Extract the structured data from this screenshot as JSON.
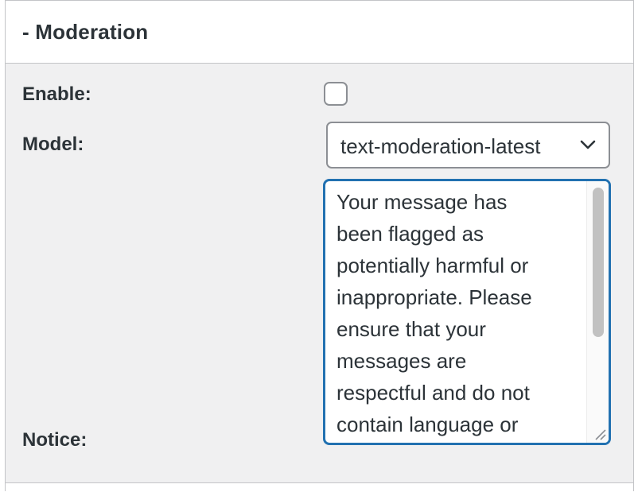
{
  "section": {
    "title": "- Moderation"
  },
  "fields": {
    "enable": {
      "label": "Enable:",
      "checked": false
    },
    "model": {
      "label": "Model:",
      "selected": "text-moderation-latest"
    },
    "notice": {
      "label": "Notice:",
      "value": "Your message has\nbeen flagged as\npotentially harmful or\ninappropriate. Please\nensure that your\nmessages are\nrespectful and do not\ncontain language or"
    }
  },
  "icons": {
    "select": "chevron-down-icon",
    "textarea_resize": "resize-grip-icon"
  },
  "colors": {
    "focus_border": "#2271b1",
    "text": "#2c3338",
    "panel_bg": "#f0f0f1"
  }
}
